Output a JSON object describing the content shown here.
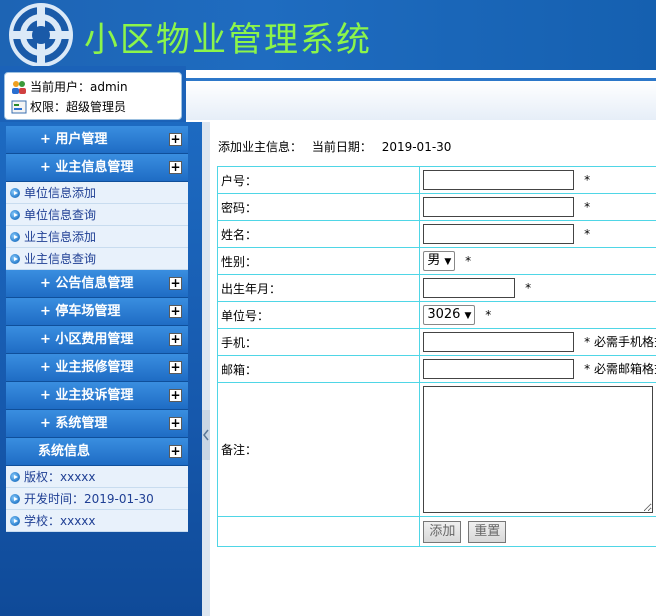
{
  "app": {
    "title": "小区物业管理系统"
  },
  "user": {
    "current_user": "当前用户：admin",
    "role": "权限：超级管理员"
  },
  "menu": [
    {
      "label": "+ 用户管理",
      "items": []
    },
    {
      "label": "+ 业主信息管理",
      "items": [
        "单位信息添加",
        "单位信息查询",
        "业主信息添加",
        "业主信息查询"
      ]
    },
    {
      "label": "+ 公告信息管理",
      "items": []
    },
    {
      "label": "+ 停车场管理",
      "items": []
    },
    {
      "label": "+ 小区费用管理",
      "items": []
    },
    {
      "label": "+ 业主报修管理",
      "items": []
    },
    {
      "label": "+ 业主投诉管理",
      "items": []
    },
    {
      "label": "+ 系统管理",
      "items": []
    },
    {
      "label": "系统信息",
      "items": [
        "版权：xxxxx",
        "开发时间：2019-01-30",
        "学校：xxxxx"
      ]
    }
  ],
  "main": {
    "caption_title": "添加业主信息：",
    "caption_date_label": "当前日期：",
    "caption_date": "2019-01-30",
    "fields": {
      "huhao": {
        "label": "户号：",
        "value": "",
        "req": "*"
      },
      "mima": {
        "label": "密码：",
        "value": "",
        "req": "*"
      },
      "xingming": {
        "label": "姓名：",
        "value": "",
        "req": "*"
      },
      "xingbie": {
        "label": "性别：",
        "value": "男",
        "req": "*"
      },
      "shengri": {
        "label": "出生年月：",
        "value": "",
        "req": "*"
      },
      "danwei": {
        "label": "单位号：",
        "value": "3026",
        "req": "*"
      },
      "shouji": {
        "label": "手机：",
        "value": "",
        "req": "* 必需手机格式"
      },
      "youxiang": {
        "label": "邮箱：",
        "value": "",
        "req": "* 必需邮箱格式"
      },
      "beizhu": {
        "label": "备注：",
        "value": ""
      }
    },
    "buttons": {
      "add": "添加",
      "reset": "重置"
    }
  }
}
